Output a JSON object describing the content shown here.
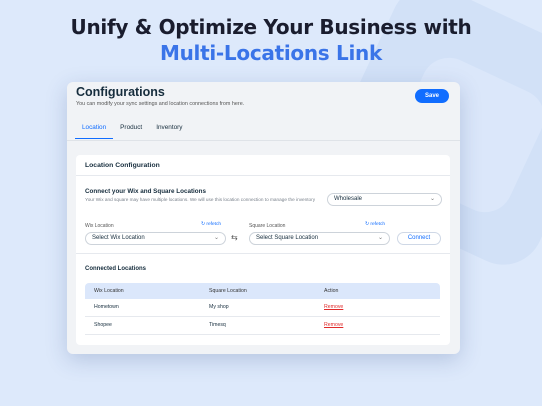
{
  "headline": {
    "line1": "Unify & Optimize Your Business with",
    "line2": "Multi-Locations Link"
  },
  "config": {
    "title": "Configurations",
    "subtitle": "You can modify your sync settings and location connections from here.",
    "save_label": "Save",
    "tabs": [
      {
        "label": "Location",
        "active": true
      },
      {
        "label": "Product",
        "active": false
      },
      {
        "label": "Inventory",
        "active": false
      }
    ]
  },
  "location_card": {
    "title": "Location Configuration",
    "connect_title": "Connect your Wix and Square Locations",
    "connect_desc": "Your Wix and square may have multiple locations. We will use this location connection to manage the inventory",
    "wholesale_value": "Wholesale",
    "wix_label": "Wix Location",
    "square_label": "Square Location",
    "refetch_label": "refetch",
    "wix_select": "Select Wix Location",
    "square_select": "Select Square Location",
    "connect_label": "Connect"
  },
  "connected": {
    "title": "Connected Locations",
    "columns": [
      "Wix Location",
      "Square Location",
      "Action"
    ],
    "rows": [
      {
        "wix": "Hometown",
        "square": "My shop",
        "action": "Remove"
      },
      {
        "wix": "Shopee",
        "square": "Timesq",
        "action": "Remove"
      }
    ]
  },
  "colors": {
    "accent": "#116dff",
    "headline_accent": "#3a74e8",
    "remove": "#e02a2a",
    "background": "#dde9fb"
  },
  "icons": {
    "chevron": "chevron-down-icon",
    "refetch": "refresh-icon",
    "swap": "swap-icon"
  }
}
